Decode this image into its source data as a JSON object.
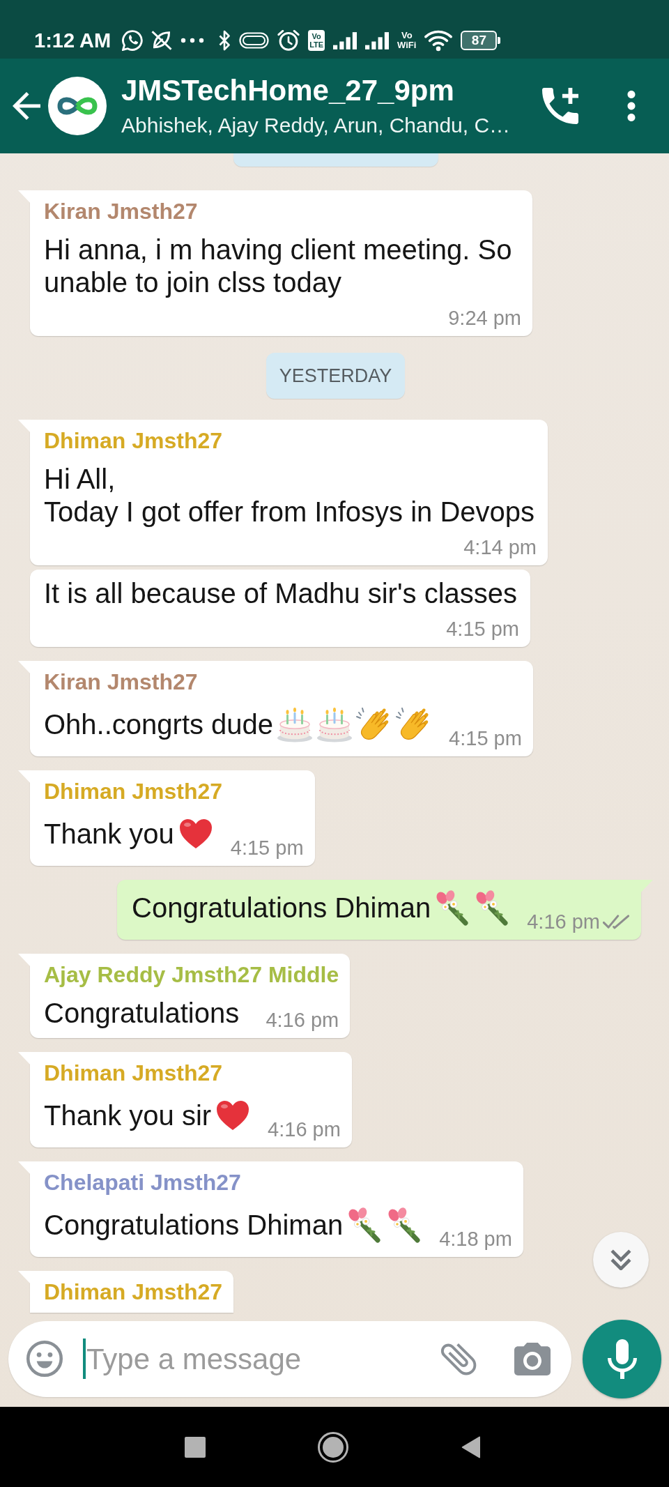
{
  "status_bar": {
    "time": "1:12 AM",
    "icons": [
      {
        "kind": "whatsapp"
      },
      {
        "kind": "slashed-leaf"
      },
      {
        "kind": "dots"
      },
      {
        "kind": "bluetooth"
      },
      {
        "kind": "pill"
      },
      {
        "kind": "alarm"
      },
      {
        "kind": "volte",
        "top": "Vo",
        "bottom": "LTE"
      },
      {
        "kind": "signal"
      },
      {
        "kind": "signal"
      },
      {
        "kind": "vowifi",
        "top": "Vo",
        "bottom": "WiFi"
      },
      {
        "kind": "wifi"
      },
      {
        "kind": "battery",
        "text": "87"
      }
    ]
  },
  "header": {
    "title": "JMSTechHome_27_9pm",
    "subtitle": "Abhishek, Ajay Reddy, Arun, Chandu, C…"
  },
  "chat": [
    {
      "kind": "date",
      "cut": true
    },
    {
      "kind": "incoming",
      "tail": true,
      "cut": false,
      "sender": "Kiran Jmsth27",
      "color": "#b3876d",
      "text": "Hi anna, i m having client meeting. So unable to join clss today",
      "time": "9:24 pm"
    },
    {
      "kind": "date",
      "label": "YESTERDAY",
      "cut": false
    },
    {
      "kind": "incoming",
      "tail": true,
      "cut": false,
      "sender": "Dhiman Jmsth27",
      "color": "#d6aa24",
      "text": "Hi All,\nToday I got offer from Infosys in Devops",
      "time": "4:14 pm"
    },
    {
      "kind": "incoming",
      "tail": false,
      "cut": false,
      "text": "It is all because of Madhu sir's classes",
      "time": "4:15 pm"
    },
    {
      "kind": "incoming",
      "tail": true,
      "cut": false,
      "sender": "Kiran Jmsth27",
      "color": "#b3876d",
      "text": "Ohh..congrts dude",
      "emoji": [
        {
          "kind": "cake"
        },
        {
          "kind": "cake"
        },
        {
          "kind": "clap"
        },
        {
          "kind": "clap"
        }
      ],
      "time": "4:15 pm"
    },
    {
      "kind": "incoming",
      "tail": true,
      "cut": false,
      "sender": "Dhiman Jmsth27",
      "color": "#d6aa24",
      "text": "Thank you",
      "emoji": [
        {
          "kind": "heart"
        }
      ],
      "time": "4:15 pm"
    },
    {
      "kind": "outgoing",
      "tail": true,
      "cut": false,
      "text": "Congratulations Dhiman",
      "emoji": [
        {
          "kind": "bouquet"
        },
        {
          "kind": "bouquet"
        }
      ],
      "time": "4:16 pm",
      "read": false
    },
    {
      "kind": "incoming",
      "tail": true,
      "cut": false,
      "sender": "Ajay Reddy Jmsth27 Middle",
      "color": "#a6bd45",
      "text": "Congratulations",
      "time": "4:16 pm"
    },
    {
      "kind": "incoming",
      "tail": true,
      "cut": false,
      "sender": "Dhiman Jmsth27",
      "color": "#d6aa24",
      "text": "Thank you sir",
      "emoji": [
        {
          "kind": "heart"
        }
      ],
      "time": "4:16 pm"
    },
    {
      "kind": "incoming",
      "tail": true,
      "cut": false,
      "sender": "Chelapati Jmsth27",
      "color": "#8592c8",
      "text": "Congratulations Dhiman",
      "emoji": [
        {
          "kind": "bouquet"
        },
        {
          "kind": "bouquet"
        }
      ],
      "time": "4:18 pm"
    },
    {
      "kind": "incoming",
      "tail": true,
      "cut": true,
      "sender": "Dhiman Jmsth27",
      "color": "#d6aa24"
    }
  ],
  "composer": {
    "placeholder": "Type a message",
    "focused": true
  }
}
